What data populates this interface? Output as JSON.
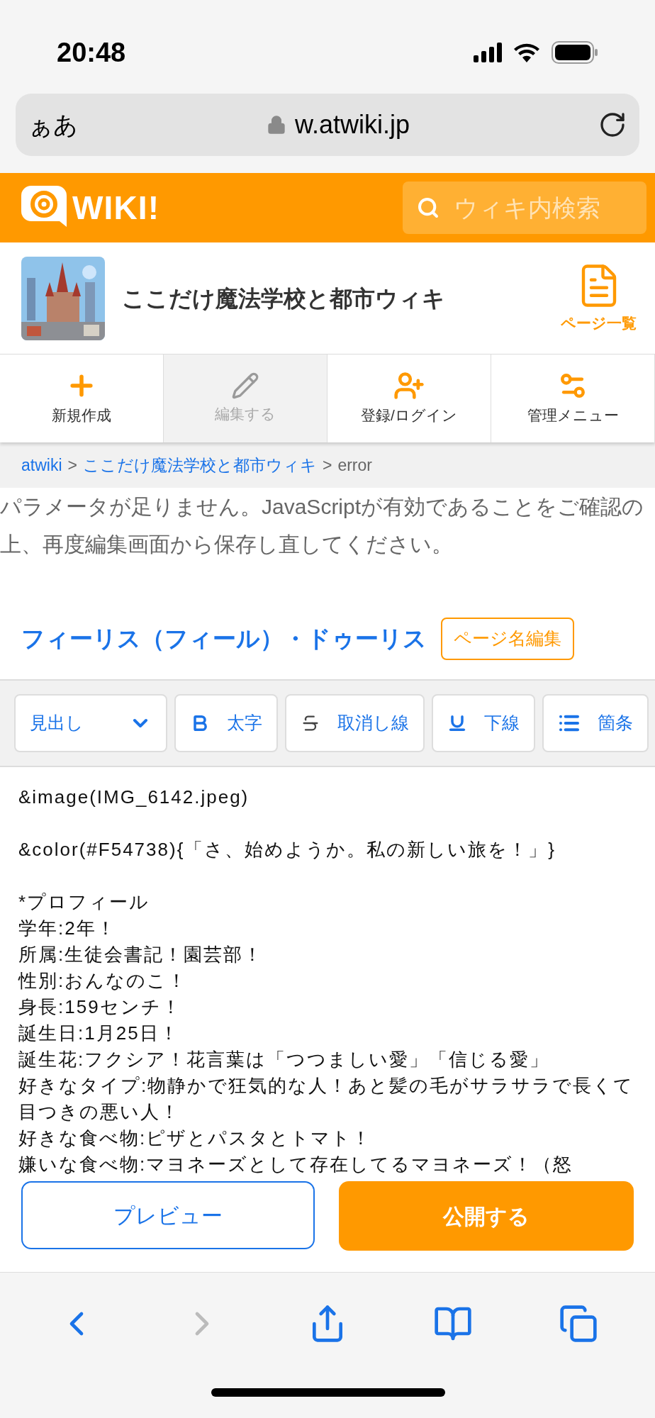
{
  "status_bar": {
    "time": "20:48"
  },
  "address_bar": {
    "text_size": "ぁあ",
    "url": "w.atwiki.jp"
  },
  "header": {
    "logo": "WIKI!",
    "search": {
      "placeholder": "ウィキ内検索"
    }
  },
  "site": {
    "title": "ここだけ魔法学校と都市ウィキ",
    "page_list": "ページ一覧"
  },
  "nav": [
    {
      "label": "新規作成",
      "kind": "create",
      "disabled": false
    },
    {
      "label": "編集する",
      "kind": "edit",
      "disabled": true
    },
    {
      "label": "登録/ログイン",
      "kind": "login",
      "disabled": false
    },
    {
      "label": "管理メニュー",
      "kind": "admin",
      "disabled": false
    }
  ],
  "breadcrumb": [
    {
      "label": "atwiki",
      "kind": "link"
    },
    {
      "label": ">",
      "kind": "sep"
    },
    {
      "label": "ここだけ魔法学校と都市ウィキ",
      "kind": "link"
    },
    {
      "label": ">",
      "kind": "sep"
    },
    {
      "label": "error",
      "kind": "current"
    }
  ],
  "error_message": "パラメータが足りません。JavaScriptが有効であることをご確認の上、再度編集画面から保存し直してください。",
  "page_title": "フィーリス（フィール）・ドゥーリス",
  "rename_button": "ページ名編集",
  "toolbar": [
    {
      "label": "見出し",
      "kind": "dropdown"
    },
    {
      "label": "太字",
      "kind": "bold"
    },
    {
      "label": "取消し線",
      "kind": "strike"
    },
    {
      "label": "下線",
      "kind": "underline"
    },
    {
      "label": "箇条",
      "kind": "list"
    }
  ],
  "editor": {
    "blocks": [
      [
        "&image(IMG_6142.jpeg)"
      ],
      [
        "&color(#F54738){「さ、始めようか。私の新しい旅を！」}"
      ],
      [
        "*プロフィール",
        "学年:2年！",
        "所属:生徒会書記！園芸部！",
        "性別:おんなのこ！",
        "身長:159センチ！",
        "誕生日:1月25日！",
        "誕生花:フクシア！花言葉は「つつましい愛」「信じる愛」",
        "好きなタイプ:物静かで狂気的な人！あと髪の毛がサラサラで長くて目つきの悪い人！",
        "好きな食べ物:ピザとパスタとトマト！",
        "嫌いな食べ物:マヨネーズとして存在してるマヨネーズ！（怒"
      ]
    ]
  },
  "actions": {
    "preview": "プレビュー",
    "publish": "公開する"
  }
}
